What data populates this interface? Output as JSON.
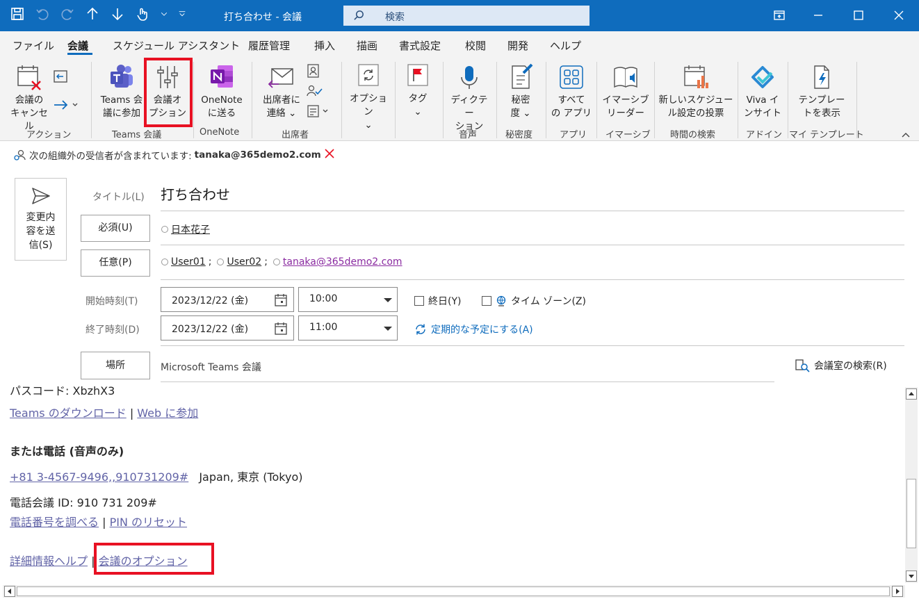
{
  "window": {
    "title": "打ち合わせ  -  会議",
    "search_placeholder": "検索"
  },
  "menu": {
    "items": [
      "ファイル",
      "会議",
      "スケジュール アシスタント",
      "履歴管理",
      "挿入",
      "描画",
      "書式設定",
      "校閲",
      "開発",
      "ヘルプ"
    ],
    "active": "会議"
  },
  "ribbon": {
    "cancel_line1": "会議の",
    "cancel_line2": "キャンセル",
    "teams_join_line1": "Teams 会",
    "teams_join_line2": "議に参加",
    "meeting_options_line1": "会議オ",
    "meeting_options_line2": "プション",
    "onenote_line1": "OneNote",
    "onenote_line2": "に送る",
    "contact_line1": "出席者に",
    "contact_line2": "連絡 ⌄",
    "options_label": "オプション",
    "tag_label": "タグ",
    "dictate_line1": "ディクテー",
    "dictate_line2": "ション",
    "sensitivity_line1": "秘密",
    "sensitivity_line2": "度 ⌄",
    "all_apps_line1": "すべて",
    "all_apps_line2": "の アプリ",
    "immersive_line1": "イマーシブ",
    "immersive_line2": "リーダー",
    "poll_line1": "新しいスケジュー",
    "poll_line2": "ル設定の投票",
    "viva_line1": "Viva イ",
    "viva_line2": "ンサイト",
    "template_line1": "テンプレー",
    "template_line2": "トを表示",
    "groups": [
      "アクション",
      "Teams 会議",
      "OneNote",
      "出席者",
      "音声",
      "秘密度",
      "アプリ",
      "イマーシブ",
      "時間の検索",
      "アドイン",
      "マイ テンプレート"
    ]
  },
  "notice": {
    "text": "次の組織外の受信者が含まれています: ",
    "email": "tanaka@365demo2.com"
  },
  "form": {
    "send_line1": "変更内",
    "send_line2": "容を送",
    "send_line3": "信(S)",
    "title_label": "タイトル(L)",
    "title_value": "打ち合わせ",
    "required_btn": "必須(U)",
    "required_attendee": "日本花子",
    "optional_btn": "任意(P)",
    "optional_1": "User01",
    "optional_2": "User02",
    "optional_3": "tanaka@365demo2.com",
    "start_label": "開始時刻(T)",
    "end_label": "終了時刻(D)",
    "start_date": "2023/12/22 (金)",
    "start_time": "10:00",
    "end_date": "2023/12/22 (金)",
    "end_time": "11:00",
    "allday": "終日(Y)",
    "timezone": "タイム ゾーン(Z)",
    "recurring": "定期的な予定にする(A)",
    "location_btn": "場所",
    "location_value": "Microsoft Teams 会議",
    "room_finder": "会議室の検索(R)"
  },
  "body": {
    "passcode": "パスコード: XbzhX3",
    "download": "Teams のダウンロード",
    "web_join": "Web に参加",
    "phone_heading": "または電話 (音声のみ)",
    "phone_number": "+81 3-4567-9496,,910731209#",
    "phone_location": "Japan, 東京 (Tokyo)",
    "conf_id": "電話会議 ID: 910 731 209#",
    "find_number": "電話番号を調べる",
    "reset_pin": "PIN のリセット",
    "help": "詳細情報ヘルプ",
    "meeting_options": "会議のオプション",
    "pipe": "|"
  }
}
